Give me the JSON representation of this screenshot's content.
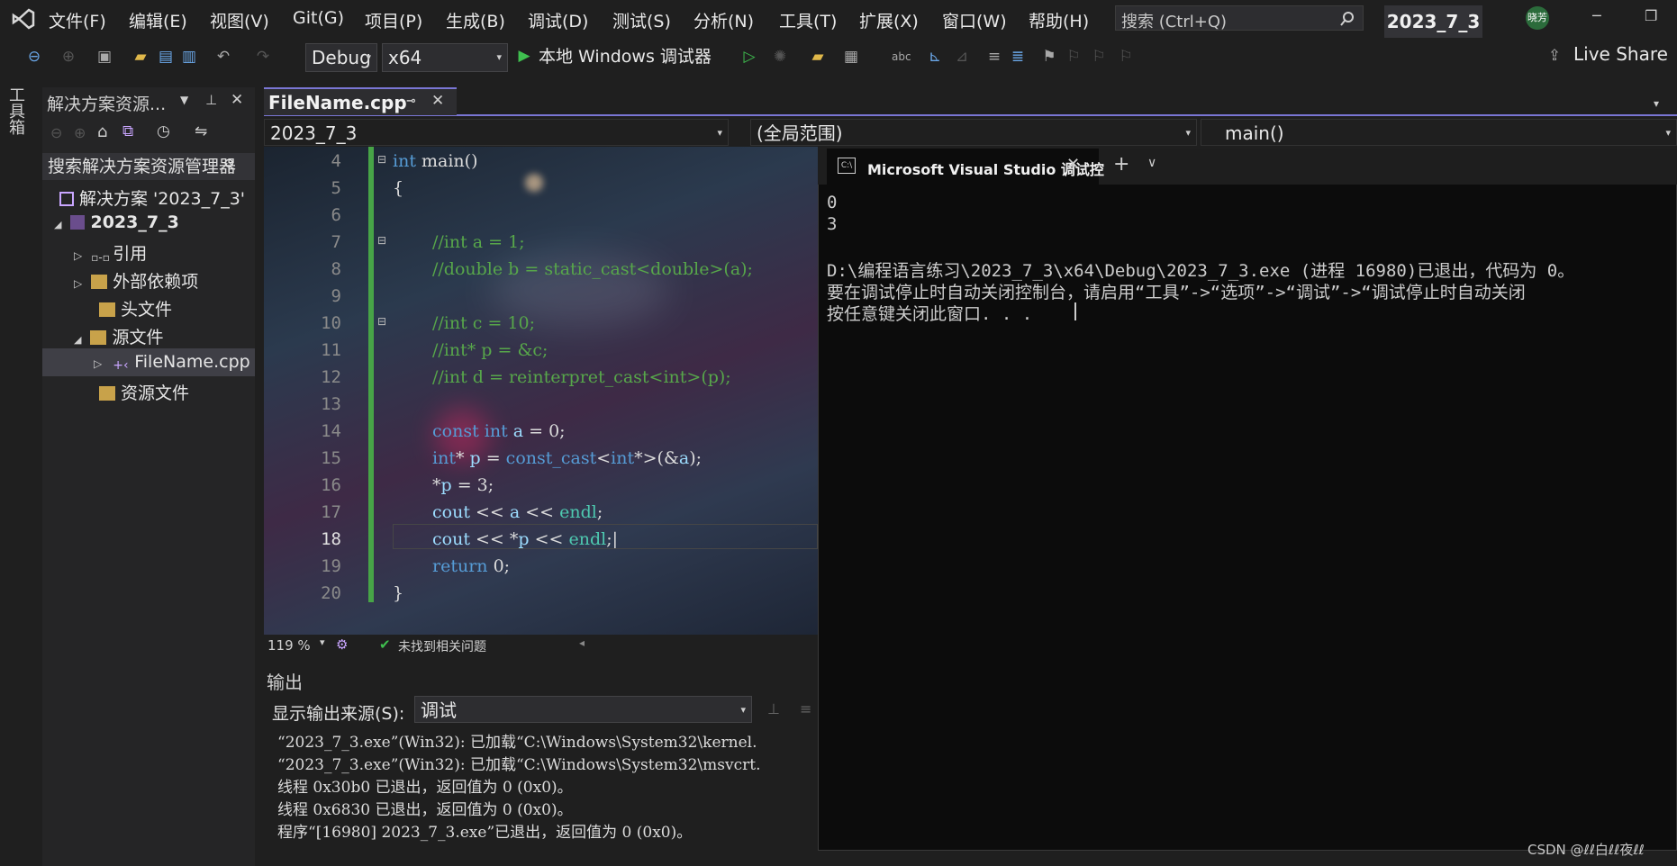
{
  "menu": [
    "文件(F)",
    "编辑(E)",
    "视图(V)",
    "Git(G)",
    "项目(P)",
    "生成(B)",
    "调试(D)",
    "测试(S)",
    "分析(N)",
    "工具(T)",
    "扩展(X)",
    "窗口(W)",
    "帮助(H)"
  ],
  "search": {
    "text": "搜索 (Ctrl+Q)"
  },
  "solution_name": "2023_7_3",
  "avatar_text": "晓芳",
  "toolbar": {
    "config": "Debug",
    "platform": "x64",
    "run_label": "本地 Windows 调试器",
    "live_share": "Live Share"
  },
  "toolbox_label": "工具箱",
  "solution_explorer": {
    "title": "解决方案资源...",
    "search_placeholder": "搜索解决方案资源管理器",
    "items": [
      {
        "label": "解决方案 '2023_7_3'"
      },
      {
        "label": "2023_7_3"
      },
      {
        "label": "引用"
      },
      {
        "label": "外部依赖项"
      },
      {
        "label": "头文件"
      },
      {
        "label": "源文件"
      },
      {
        "label": "FileName.cpp"
      },
      {
        "label": "资源文件"
      }
    ]
  },
  "editor": {
    "tab_label": "FileName.cpp",
    "nav_project": "2023_7_3",
    "nav_scope": "(全局范围)",
    "nav_member": "main()",
    "line_numbers": [
      "4",
      "5",
      "6",
      "7",
      "8",
      "9",
      "10",
      "11",
      "12",
      "13",
      "14",
      "15",
      "16",
      "17",
      "18",
      "19",
      "20"
    ],
    "zoom": "119 %",
    "issues": "未找到相关问题"
  },
  "output": {
    "title": "输出",
    "source_label": "显示输出来源(S):",
    "source_value": "调试",
    "lines": [
      "“2023_7_3.exe”(Win32): 已加载“C:\\Windows\\System32\\kernel.",
      "“2023_7_3.exe”(Win32): 已加载“C:\\Windows\\System32\\msvcrt.",
      "线程 0x30b0 已退出，返回值为 0 (0x0)。",
      "线程 0x6830 已退出，返回值为 0 (0x0)。",
      "程序“[16980] 2023_7_3.exe”已退出，返回值为 0 (0x0)。"
    ]
  },
  "console": {
    "tab_title": "Microsoft Visual Studio 调试控",
    "lines": [
      "0",
      "3",
      "",
      "D:\\编程语言练习\\2023_7_3\\x64\\Debug\\2023_7_3.exe (进程 16980)已退出，代码为 0。",
      "要在调试停止时自动关闭控制台，请启用“工具”->“选项”->“调试”->“调试停止时自动关闭",
      "按任意键关闭此窗口. . ."
    ]
  },
  "watermark": "CSDN @ℓℓ白ℓℓ夜ℓℓ"
}
